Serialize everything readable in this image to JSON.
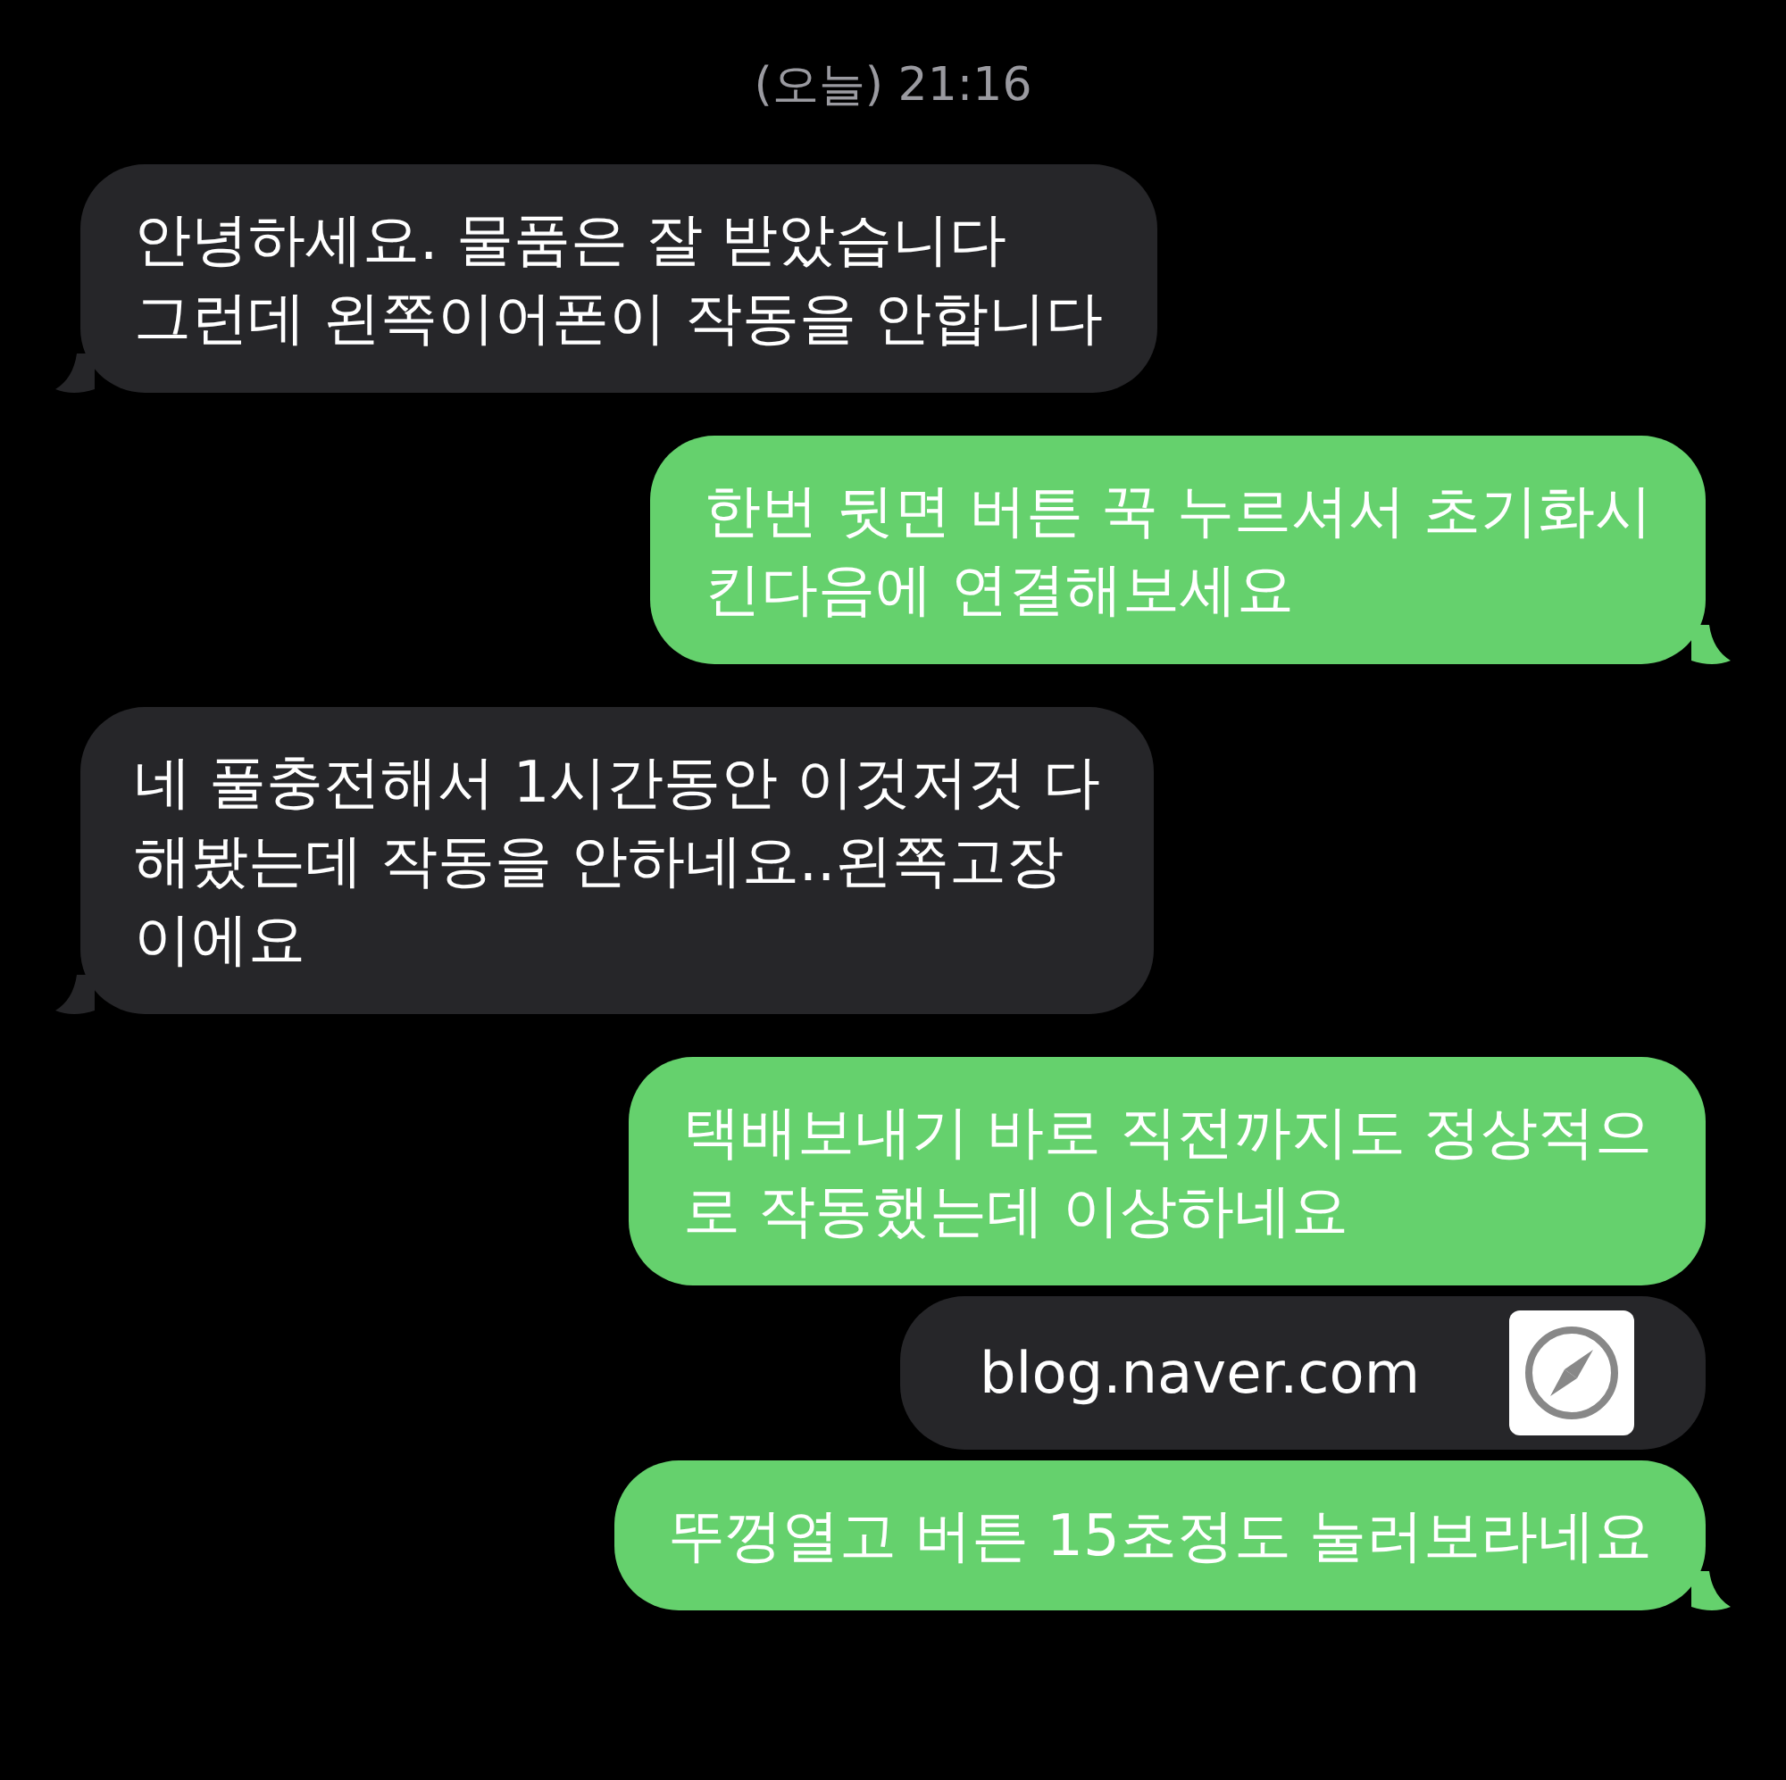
{
  "timestamp": "(오늘) 21:16",
  "messages": [
    {
      "kind": "received",
      "lines": [
        "안녕하세요. 물품은 잘 받았습니다",
        "그런데 왼쪽이어폰이 작동을 안합니다"
      ],
      "tail": true
    },
    {
      "kind": "sent",
      "lines": [
        "한번 뒷면 버튼 꾹 누르셔서 초기화시",
        "킨다음에 연결해보세요"
      ],
      "tail": true
    },
    {
      "kind": "received",
      "lines": [
        "네 풀충전해서 1시간동안 이것저것 다",
        "해봤는데 작동을 안하네요..왼쪽고장",
        "이에요"
      ],
      "tail": true
    },
    {
      "kind": "sent",
      "lines": [
        "택배보내기 바로 직전까지도 정상적으",
        "로 작동했는데 이상하네요"
      ],
      "tail": false
    },
    {
      "kind": "link",
      "lines": [
        "blog.naver.com"
      ],
      "tail": false
    },
    {
      "kind": "sent",
      "lines": [
        "뚜껑열고 버튼 15초정도 눌러보라네요"
      ],
      "tail": true
    }
  ]
}
